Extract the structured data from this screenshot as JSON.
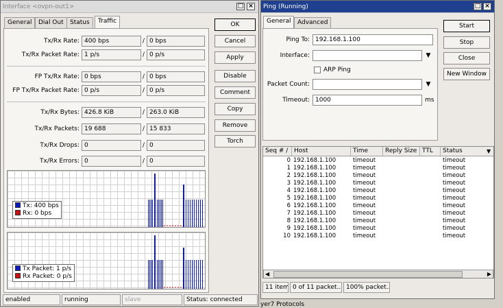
{
  "interface_window": {
    "title": "Interface <ovpn-out1>",
    "tabs": [
      "General",
      "Dial Out",
      "Status",
      "Traffic"
    ],
    "selected_tab": "Traffic",
    "fields": {
      "txrx_rate": {
        "label": "Tx/Rx Rate:",
        "tx": "400 bps",
        "rx": "0 bps"
      },
      "txrx_packet_rate": {
        "label": "Tx/Rx Packet Rate:",
        "tx": "1 p/s",
        "rx": "0 p/s"
      },
      "fp_txrx_rate": {
        "label": "FP Tx/Rx Rate:",
        "tx": "0 bps",
        "rx": "0 bps"
      },
      "fp_txrx_packet_rate": {
        "label": "FP Tx/Rx Packet Rate:",
        "tx": "0 p/s",
        "rx": "0 p/s"
      },
      "txrx_bytes": {
        "label": "Tx/Rx Bytes:",
        "tx": "426.8 KiB",
        "rx": "263.0 KiB"
      },
      "txrx_packets": {
        "label": "Tx/Rx Packets:",
        "tx": "19 688",
        "rx": "15 833"
      },
      "txrx_drops": {
        "label": "Tx/Rx Drops:",
        "tx": "0",
        "rx": "0"
      },
      "txrx_errors": {
        "label": "Tx/Rx Errors:",
        "tx": "0",
        "rx": "0"
      }
    },
    "slash": "/",
    "buttons": [
      "OK",
      "Cancel",
      "Apply",
      "Disable",
      "Comment",
      "Copy",
      "Remove",
      "Torch"
    ],
    "graph1_legend": {
      "tx": "Tx:  400 bps",
      "rx": "Rx:  0 bps"
    },
    "graph2_legend": {
      "tx": "Tx Packet:  1 p/s",
      "rx": "Rx Packet:  0 p/s"
    },
    "status_bar": {
      "s1": "enabled",
      "s2": "running",
      "s3": "slave",
      "s4": "Status: connected"
    }
  },
  "ping_window": {
    "title": "Ping (Running)",
    "tabs": [
      "General",
      "Advanced"
    ],
    "selected_tab": "General",
    "ping_to": {
      "label": "Ping To:",
      "value": "192.168.1.100"
    },
    "interface": {
      "label": "Interface:",
      "value": ""
    },
    "arp_ping": {
      "label": "ARP Ping",
      "checked": false
    },
    "packet_count": {
      "label": "Packet Count:",
      "value": ""
    },
    "timeout": {
      "label": "Timeout:",
      "value": "1000",
      "unit": "ms"
    },
    "buttons": [
      "Start",
      "Stop",
      "Close",
      "New Window"
    ],
    "table": {
      "columns": [
        "Seq # /",
        "Host",
        "Time",
        "Reply Size",
        "TTL",
        "Status"
      ],
      "rows": [
        {
          "seq": "0",
          "host": "192.168.1.100",
          "time": "timeout",
          "status": "timeout"
        },
        {
          "seq": "1",
          "host": "192.168.1.100",
          "time": "timeout",
          "status": "timeout"
        },
        {
          "seq": "2",
          "host": "192.168.1.100",
          "time": "timeout",
          "status": "timeout"
        },
        {
          "seq": "3",
          "host": "192.168.1.100",
          "time": "timeout",
          "status": "timeout"
        },
        {
          "seq": "4",
          "host": "192.168.1.100",
          "time": "timeout",
          "status": "timeout"
        },
        {
          "seq": "5",
          "host": "192.168.1.100",
          "time": "timeout",
          "status": "timeout"
        },
        {
          "seq": "6",
          "host": "192.168.1.100",
          "time": "timeout",
          "status": "timeout"
        },
        {
          "seq": "7",
          "host": "192.168.1.100",
          "time": "timeout",
          "status": "timeout"
        },
        {
          "seq": "8",
          "host": "192.168.1.100",
          "time": "timeout",
          "status": "timeout"
        },
        {
          "seq": "9",
          "host": "192.168.1.100",
          "time": "timeout",
          "status": "timeout"
        },
        {
          "seq": "10",
          "host": "192.168.1.100",
          "time": "timeout",
          "status": "timeout"
        }
      ]
    },
    "status_bar": {
      "items": "11 items",
      "packets": "0 of 11 packet...",
      "loss": "100% packet..."
    }
  },
  "background_text": "yer7 Protocols",
  "colors": {
    "tx": "#0a18c8",
    "rx": "#d01010",
    "titlebar_active": "#1f3f8f"
  }
}
